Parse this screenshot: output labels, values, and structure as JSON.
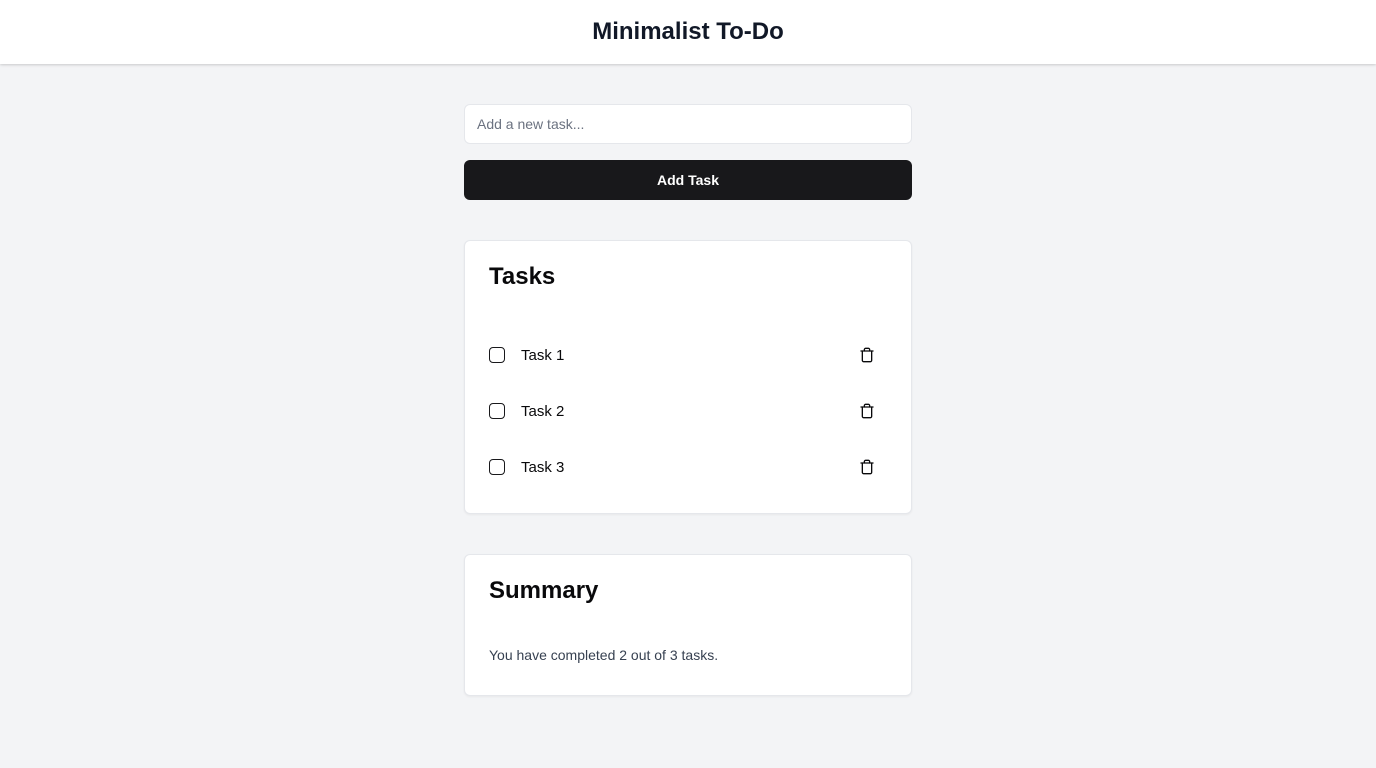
{
  "header": {
    "title": "Minimalist To-Do"
  },
  "new_task": {
    "placeholder": "Add a new task...",
    "value": "",
    "add_label": "Add Task"
  },
  "tasks_card": {
    "title": "Tasks",
    "items": [
      {
        "label": "Task 1",
        "checked": false,
        "delete_icon": "trash-icon"
      },
      {
        "label": "Task 2",
        "checked": false,
        "delete_icon": "trash-icon"
      },
      {
        "label": "Task 3",
        "checked": false,
        "delete_icon": "trash-icon"
      }
    ]
  },
  "summary_card": {
    "title": "Summary",
    "text": "You have completed 2 out of 3 tasks."
  },
  "colors": {
    "background": "#f3f4f6",
    "surface": "#ffffff",
    "primary_button": "#18181b",
    "text": "#111827",
    "muted_text": "#374151"
  }
}
